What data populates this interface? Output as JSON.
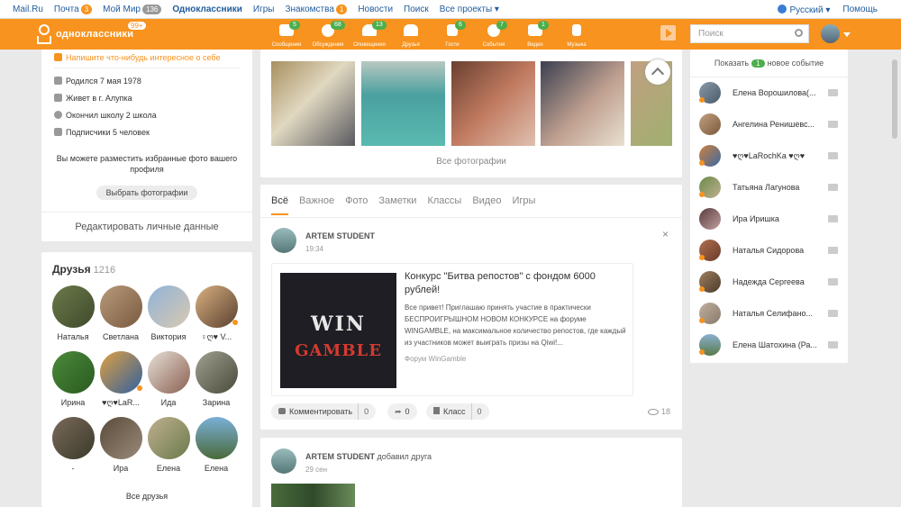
{
  "topbar": {
    "links": [
      {
        "label": "Mail.Ru"
      },
      {
        "label": "Почта",
        "badge": "3"
      },
      {
        "label": "Мой Мир",
        "badge": "136"
      },
      {
        "label": "Одноклассники"
      },
      {
        "label": "Игры"
      },
      {
        "label": "Знакомства",
        "badge": "1"
      },
      {
        "label": "Новости"
      },
      {
        "label": "Поиск"
      },
      {
        "label": "Все проекты ▾"
      }
    ],
    "language": "Русский ▾",
    "help": "Помощь"
  },
  "header": {
    "logo_text": "одноклассники",
    "logo_badge": "99+",
    "nav": [
      {
        "label": "Сообщения",
        "badge": "5"
      },
      {
        "label": "Обсуждения",
        "badge": "68"
      },
      {
        "label": "Оповещения",
        "badge": "13"
      },
      {
        "label": "Друзья",
        "badge": ""
      },
      {
        "label": "Гости",
        "badge": "6"
      },
      {
        "label": "События",
        "badge": "7"
      },
      {
        "label": "Видео",
        "badge": "1"
      },
      {
        "label": "Музыка",
        "badge": ""
      }
    ],
    "search_placeholder": "Поиск"
  },
  "profile": {
    "about_prompt": "Напишите что-нибудь интересное о себе",
    "born": "Родился 7 мая 1978",
    "lives": "Живет в г. Алупка",
    "school": "Окончил школу 2 школа",
    "subscribers": "Подписчики 5 человек",
    "fav_photos_text": "Вы можете разместить избранные фото вашего профиля",
    "choose_photos": "Выбрать фотографии",
    "edit_data": "Редактировать личные данные"
  },
  "friends": {
    "title": "Друзья",
    "count": "1216",
    "list": [
      {
        "name": "Наталья"
      },
      {
        "name": "Светлана"
      },
      {
        "name": "Виктория"
      },
      {
        "name": "♀ღ♥ V..."
      },
      {
        "name": "Ирина"
      },
      {
        "name": "♥ღ♥LaR..."
      },
      {
        "name": "Ида"
      },
      {
        "name": "Зарина"
      },
      {
        "name": "-"
      },
      {
        "name": "Ира"
      },
      {
        "name": "Елена"
      },
      {
        "name": "Елена"
      }
    ],
    "all_friends": "Все друзья"
  },
  "photos": {
    "all_photos": "Все фотографии"
  },
  "feed": {
    "tabs": [
      "Всё",
      "Важное",
      "Фото",
      "Заметки",
      "Классы",
      "Видео",
      "Игры"
    ],
    "post1": {
      "author": "ARTEM STUDENT",
      "time": "19:34",
      "close": "×",
      "ad_image_line1": "WIN",
      "ad_image_line2": "GAMBLE",
      "ad_title": "Конкурс \"Битва репостов\" с фондом 6000 рублей!",
      "ad_text": "Все привет! Приглашаю принять участие в практически БЕСПРОИГРЫШНОМ НОВОМ КОНКУРСЕ на форуме WINGAMBLE, на максимальное количество репостов, где каждый из участников может выиграть призы на Qiwi!...",
      "ad_source": "Форум WinGamble",
      "comment_label": "Комментировать",
      "comment_count": "0",
      "share_count": "0",
      "like_label": "Класс",
      "like_count": "0",
      "views": "18"
    },
    "post2": {
      "author": "ARTEM STUDENT",
      "action": "добавил друга",
      "time": "29 сен"
    }
  },
  "events": {
    "show_label": "Показать",
    "count": "1",
    "new_event": "новое событие",
    "people": [
      {
        "name": "Елена Ворошилова(..."
      },
      {
        "name": "Ангелина Ренишевс..."
      },
      {
        "name": "♥ღ♥LaRochKa ♥ღ♥"
      },
      {
        "name": "Татьяна Лагунова"
      },
      {
        "name": "Ира Иришка"
      },
      {
        "name": "Наталья Сидорова"
      },
      {
        "name": "Надежда Сергеева"
      },
      {
        "name": "Наталья Селифано..."
      },
      {
        "name": "Елена Шатохина (Ра..."
      }
    ]
  }
}
